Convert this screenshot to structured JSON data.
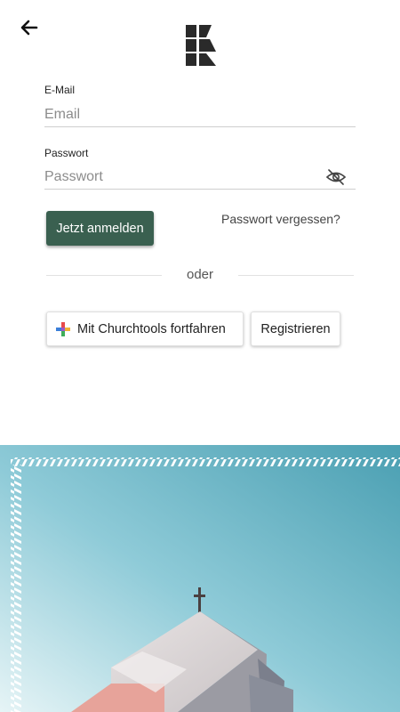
{
  "icons": {
    "back": "arrow-left-icon",
    "logo": "k-logo",
    "password_toggle": "eye-off-icon",
    "churchtools": "churchtools-cross-icon"
  },
  "colors": {
    "primary_button": "#3a6050",
    "sky_top": "#4a9fb2",
    "sky_bottom": "#d8eef3"
  },
  "form": {
    "email": {
      "label": "E-Mail",
      "placeholder": "Email",
      "value": ""
    },
    "password": {
      "label": "Passwort",
      "placeholder": "Passwort",
      "value": ""
    }
  },
  "actions": {
    "login_label": "Jetzt anmelden",
    "forgot_label": "Passwort vergessen?",
    "divider_label": "oder",
    "churchtools_label": "Mit Churchtools fortfahren",
    "register_label": "Registrieren"
  }
}
